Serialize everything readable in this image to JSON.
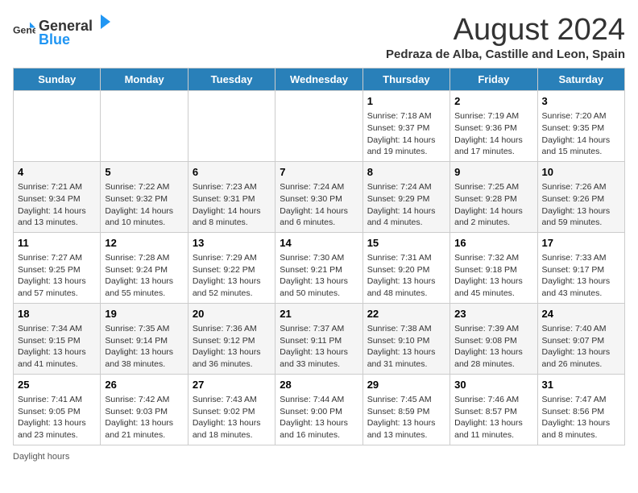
{
  "logo": {
    "text_general": "General",
    "text_blue": "Blue"
  },
  "title": {
    "month": "August 2024",
    "location": "Pedraza de Alba, Castille and Leon, Spain"
  },
  "days_of_week": [
    "Sunday",
    "Monday",
    "Tuesday",
    "Wednesday",
    "Thursday",
    "Friday",
    "Saturday"
  ],
  "footer": {
    "note": "Daylight hours"
  },
  "weeks": [
    [
      {
        "day": "",
        "info": ""
      },
      {
        "day": "",
        "info": ""
      },
      {
        "day": "",
        "info": ""
      },
      {
        "day": "",
        "info": ""
      },
      {
        "day": "1",
        "info": "Sunrise: 7:18 AM\nSunset: 9:37 PM\nDaylight: 14 hours\nand 19 minutes."
      },
      {
        "day": "2",
        "info": "Sunrise: 7:19 AM\nSunset: 9:36 PM\nDaylight: 14 hours\nand 17 minutes."
      },
      {
        "day": "3",
        "info": "Sunrise: 7:20 AM\nSunset: 9:35 PM\nDaylight: 14 hours\nand 15 minutes."
      }
    ],
    [
      {
        "day": "4",
        "info": "Sunrise: 7:21 AM\nSunset: 9:34 PM\nDaylight: 14 hours\nand 13 minutes."
      },
      {
        "day": "5",
        "info": "Sunrise: 7:22 AM\nSunset: 9:32 PM\nDaylight: 14 hours\nand 10 minutes."
      },
      {
        "day": "6",
        "info": "Sunrise: 7:23 AM\nSunset: 9:31 PM\nDaylight: 14 hours\nand 8 minutes."
      },
      {
        "day": "7",
        "info": "Sunrise: 7:24 AM\nSunset: 9:30 PM\nDaylight: 14 hours\nand 6 minutes."
      },
      {
        "day": "8",
        "info": "Sunrise: 7:24 AM\nSunset: 9:29 PM\nDaylight: 14 hours\nand 4 minutes."
      },
      {
        "day": "9",
        "info": "Sunrise: 7:25 AM\nSunset: 9:28 PM\nDaylight: 14 hours\nand 2 minutes."
      },
      {
        "day": "10",
        "info": "Sunrise: 7:26 AM\nSunset: 9:26 PM\nDaylight: 13 hours\nand 59 minutes."
      }
    ],
    [
      {
        "day": "11",
        "info": "Sunrise: 7:27 AM\nSunset: 9:25 PM\nDaylight: 13 hours\nand 57 minutes."
      },
      {
        "day": "12",
        "info": "Sunrise: 7:28 AM\nSunset: 9:24 PM\nDaylight: 13 hours\nand 55 minutes."
      },
      {
        "day": "13",
        "info": "Sunrise: 7:29 AM\nSunset: 9:22 PM\nDaylight: 13 hours\nand 52 minutes."
      },
      {
        "day": "14",
        "info": "Sunrise: 7:30 AM\nSunset: 9:21 PM\nDaylight: 13 hours\nand 50 minutes."
      },
      {
        "day": "15",
        "info": "Sunrise: 7:31 AM\nSunset: 9:20 PM\nDaylight: 13 hours\nand 48 minutes."
      },
      {
        "day": "16",
        "info": "Sunrise: 7:32 AM\nSunset: 9:18 PM\nDaylight: 13 hours\nand 45 minutes."
      },
      {
        "day": "17",
        "info": "Sunrise: 7:33 AM\nSunset: 9:17 PM\nDaylight: 13 hours\nand 43 minutes."
      }
    ],
    [
      {
        "day": "18",
        "info": "Sunrise: 7:34 AM\nSunset: 9:15 PM\nDaylight: 13 hours\nand 41 minutes."
      },
      {
        "day": "19",
        "info": "Sunrise: 7:35 AM\nSunset: 9:14 PM\nDaylight: 13 hours\nand 38 minutes."
      },
      {
        "day": "20",
        "info": "Sunrise: 7:36 AM\nSunset: 9:12 PM\nDaylight: 13 hours\nand 36 minutes."
      },
      {
        "day": "21",
        "info": "Sunrise: 7:37 AM\nSunset: 9:11 PM\nDaylight: 13 hours\nand 33 minutes."
      },
      {
        "day": "22",
        "info": "Sunrise: 7:38 AM\nSunset: 9:10 PM\nDaylight: 13 hours\nand 31 minutes."
      },
      {
        "day": "23",
        "info": "Sunrise: 7:39 AM\nSunset: 9:08 PM\nDaylight: 13 hours\nand 28 minutes."
      },
      {
        "day": "24",
        "info": "Sunrise: 7:40 AM\nSunset: 9:07 PM\nDaylight: 13 hours\nand 26 minutes."
      }
    ],
    [
      {
        "day": "25",
        "info": "Sunrise: 7:41 AM\nSunset: 9:05 PM\nDaylight: 13 hours\nand 23 minutes."
      },
      {
        "day": "26",
        "info": "Sunrise: 7:42 AM\nSunset: 9:03 PM\nDaylight: 13 hours\nand 21 minutes."
      },
      {
        "day": "27",
        "info": "Sunrise: 7:43 AM\nSunset: 9:02 PM\nDaylight: 13 hours\nand 18 minutes."
      },
      {
        "day": "28",
        "info": "Sunrise: 7:44 AM\nSunset: 9:00 PM\nDaylight: 13 hours\nand 16 minutes."
      },
      {
        "day": "29",
        "info": "Sunrise: 7:45 AM\nSunset: 8:59 PM\nDaylight: 13 hours\nand 13 minutes."
      },
      {
        "day": "30",
        "info": "Sunrise: 7:46 AM\nSunset: 8:57 PM\nDaylight: 13 hours\nand 11 minutes."
      },
      {
        "day": "31",
        "info": "Sunrise: 7:47 AM\nSunset: 8:56 PM\nDaylight: 13 hours\nand 8 minutes."
      }
    ]
  ]
}
